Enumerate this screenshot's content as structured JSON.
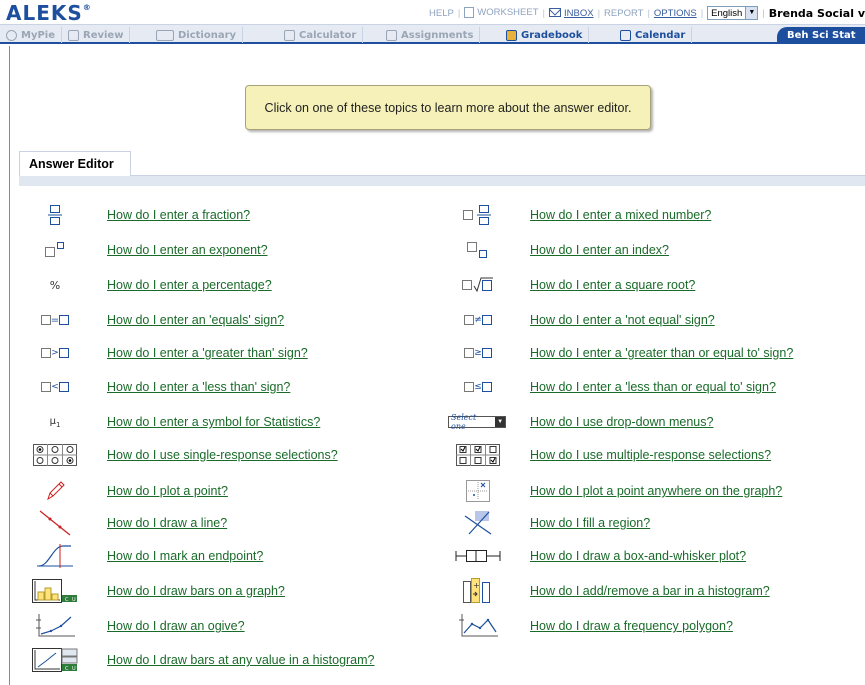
{
  "header": {
    "logo": "ALEKS",
    "logo_mark": "®",
    "links": {
      "help": "HELP",
      "worksheet": "WORKSHEET",
      "inbox": "INBOX",
      "report": "REPORT",
      "options": "OPTIONS"
    },
    "language": "English",
    "user": "Brenda Social v"
  },
  "nav": {
    "tabs": [
      "MyPie",
      "Review",
      "Dictionary",
      "Calculator",
      "Assignments",
      "Gradebook",
      "Calendar"
    ],
    "course": "Beh Sci Stat"
  },
  "tooltip": "Click on one of these topics to learn more about the answer editor.",
  "section": {
    "title": "Answer Editor"
  },
  "topics_left": [
    {
      "icon": "fraction-icon",
      "label": "How do I enter a fraction?"
    },
    {
      "icon": "exponent-icon",
      "label": "How do I enter an exponent?"
    },
    {
      "icon": "percent-icon",
      "glyph": "%",
      "label": "How do I enter a percentage?"
    },
    {
      "icon": "equals-icon",
      "glyph": "=",
      "label": "How do I enter an 'equals' sign?"
    },
    {
      "icon": "greater-than-icon",
      "glyph": ">",
      "label": "How do I enter a 'greater than' sign?"
    },
    {
      "icon": "less-than-icon",
      "glyph": "<",
      "label": "How do I enter a 'less than' sign?"
    },
    {
      "icon": "statistics-symbol-icon",
      "glyph": "μ",
      "glyph_sub": "1",
      "label": "How do I enter a symbol for Statistics?"
    },
    {
      "icon": "radio-buttons-icon",
      "label": "How do I use single-response selections?"
    },
    {
      "icon": "pencil-icon",
      "label": "How do I plot a point?"
    },
    {
      "icon": "draw-line-icon",
      "label": "How do I draw a line?"
    },
    {
      "icon": "endpoint-curve-icon",
      "label": "How do I mark an endpoint?"
    },
    {
      "icon": "bar-graph-icon",
      "label": "How do I draw bars on a graph?"
    },
    {
      "icon": "ogive-icon",
      "label": "How do I draw an ogive?"
    },
    {
      "icon": "histogram-bars-icon",
      "label": "How do I draw bars at any value in a histogram?"
    }
  ],
  "topics_right": [
    {
      "icon": "mixed-number-icon",
      "label": "How do I enter a mixed number?"
    },
    {
      "icon": "index-icon",
      "label": "How do I enter an index?"
    },
    {
      "icon": "square-root-icon",
      "label": "How do I enter a square root?"
    },
    {
      "icon": "not-equal-icon",
      "glyph": "≠",
      "label": "How do I enter a 'not equal' sign?"
    },
    {
      "icon": "greater-equal-icon",
      "glyph": "≥",
      "label": "How do I enter a 'greater than or equal to' sign?"
    },
    {
      "icon": "less-equal-icon",
      "glyph": "≤",
      "label": "How do I enter a 'less than or equal to' sign?"
    },
    {
      "icon": "select-dropdown-icon",
      "glyph": "Select one",
      "label": "How do I use drop-down menus?"
    },
    {
      "icon": "checkboxes-icon",
      "label": "How do I use multiple-response selections?"
    },
    {
      "icon": "graph-point-icon",
      "label": "How do I plot a point anywhere on the graph?"
    },
    {
      "icon": "fill-region-icon",
      "label": "How do I fill a region?"
    },
    {
      "icon": "box-whisker-icon",
      "label": "How do I draw a box-and-whisker plot?"
    },
    {
      "icon": "add-remove-bar-icon",
      "label": "How do I add/remove a bar in a histogram?"
    },
    {
      "icon": "frequency-polygon-icon",
      "label": "How do I draw a frequency polygon?"
    }
  ],
  "bar_icon_labels": {
    "c": "C",
    "u": "U"
  }
}
